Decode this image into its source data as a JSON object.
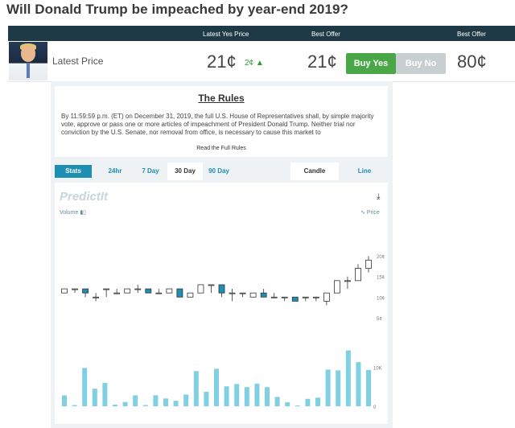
{
  "page": {
    "title": "Will Donald Trump be impeached by year-end 2019?"
  },
  "header": {
    "latest_yes_price": "Latest Yes Price",
    "best_offer_left": "Best Offer",
    "best_offer_right": "Best Offer"
  },
  "market": {
    "latest_label": "Latest Price",
    "latest_price": "21¢",
    "change": "2¢",
    "change_icon": "up-arrow-icon",
    "yes_offer": "21¢",
    "buy_yes": "Buy Yes",
    "buy_no": "Buy No",
    "no_offer": "80¢"
  },
  "rules": {
    "title": "The Rules",
    "text": "By 11:59:59 p.m. (ET) on December 31, 2019, the full U.S. House of Representatives shall, by simple majority vote, approve or pass one or more articles of impeachment of President Donald Trump. Neither trial nor conviction by the U.S. Senate, nor removal from office, is necessary to cause this market to",
    "link": "Read the Full Rules"
  },
  "tabs": {
    "stats": "Stats",
    "h24": "24hr",
    "d7": "7 Day",
    "d30": "30 Day",
    "d90": "90 Day",
    "candle": "Candle",
    "line": "Line"
  },
  "chart_labels": {
    "logo": "PredictIt",
    "volume": "Volume",
    "price": "Price"
  },
  "colors": {
    "accent": "#1e8fb3",
    "header_bg": "#1f3a47",
    "buy_yes": "#4aa748",
    "buy_no": "#c9ced0",
    "volume_bar": "#7fd0e3",
    "candle_down": "#1e8fb3"
  },
  "chart_data": {
    "type": "candlestick",
    "price_ticks": [
      "20¢",
      "15¢",
      "10¢",
      "5¢"
    ],
    "price_tick_values": [
      20,
      15,
      10,
      5
    ],
    "volume_ticks": [
      "10K",
      "0"
    ],
    "volume_tick_values": [
      10000,
      0
    ],
    "price_ylim": [
      0,
      22
    ],
    "volume_ylim": [
      0,
      14000
    ],
    "candles": [
      {
        "o": 11,
        "c": 12,
        "h": 12,
        "l": 11
      },
      {
        "o": 12,
        "c": 12,
        "h": 12,
        "l": 11
      },
      {
        "o": 12,
        "c": 11,
        "h": 12,
        "l": 10
      },
      {
        "o": 10,
        "c": 10,
        "h": 11,
        "l": 9
      },
      {
        "o": 12,
        "c": 12,
        "h": 12,
        "l": 10
      },
      {
        "o": 11,
        "c": 11,
        "h": 12,
        "l": 11
      },
      {
        "o": 11,
        "c": 12,
        "h": 12,
        "l": 11
      },
      {
        "o": 12,
        "c": 12,
        "h": 13,
        "l": 11
      },
      {
        "o": 12,
        "c": 11,
        "h": 12,
        "l": 11
      },
      {
        "o": 11,
        "c": 11,
        "h": 12,
        "l": 11
      },
      {
        "o": 11,
        "c": 12,
        "h": 12,
        "l": 11
      },
      {
        "o": 12,
        "c": 10,
        "h": 12,
        "l": 10
      },
      {
        "o": 10,
        "c": 11,
        "h": 11,
        "l": 10
      },
      {
        "o": 11,
        "c": 13,
        "h": 13,
        "l": 11
      },
      {
        "o": 13,
        "c": 13,
        "h": 13,
        "l": 11
      },
      {
        "o": 13,
        "c": 11,
        "h": 13,
        "l": 10
      },
      {
        "o": 11,
        "c": 11,
        "h": 12,
        "l": 9
      },
      {
        "o": 11,
        "c": 11,
        "h": 11,
        "l": 10
      },
      {
        "o": 10,
        "c": 11,
        "h": 11,
        "l": 10
      },
      {
        "o": 11,
        "c": 10,
        "h": 12,
        "l": 10
      },
      {
        "o": 10,
        "c": 10,
        "h": 11,
        "l": 10
      },
      {
        "o": 10,
        "c": 10,
        "h": 10,
        "l": 9
      },
      {
        "o": 10,
        "c": 9,
        "h": 10,
        "l": 9
      },
      {
        "o": 10,
        "c": 10,
        "h": 10,
        "l": 9
      },
      {
        "o": 10,
        "c": 10,
        "h": 10,
        "l": 9
      },
      {
        "o": 9,
        "c": 11,
        "h": 11,
        "l": 8
      },
      {
        "o": 11,
        "c": 14,
        "h": 14,
        "l": 11
      },
      {
        "o": 14,
        "c": 14,
        "h": 15,
        "l": 12
      },
      {
        "o": 14,
        "c": 17,
        "h": 18,
        "l": 14
      },
      {
        "o": 17,
        "c": 19,
        "h": 20,
        "l": 16
      }
    ],
    "volumes": [
      2800,
      300,
      9800,
      4500,
      6000,
      400,
      1100,
      2800,
      300,
      2800,
      2000,
      1400,
      3000,
      9000,
      3700,
      9600,
      5100,
      5700,
      4900,
      5800,
      4900,
      2400,
      1000,
      200,
      1900,
      2200,
      9400,
      9200,
      14300,
      11300,
      9300
    ]
  }
}
